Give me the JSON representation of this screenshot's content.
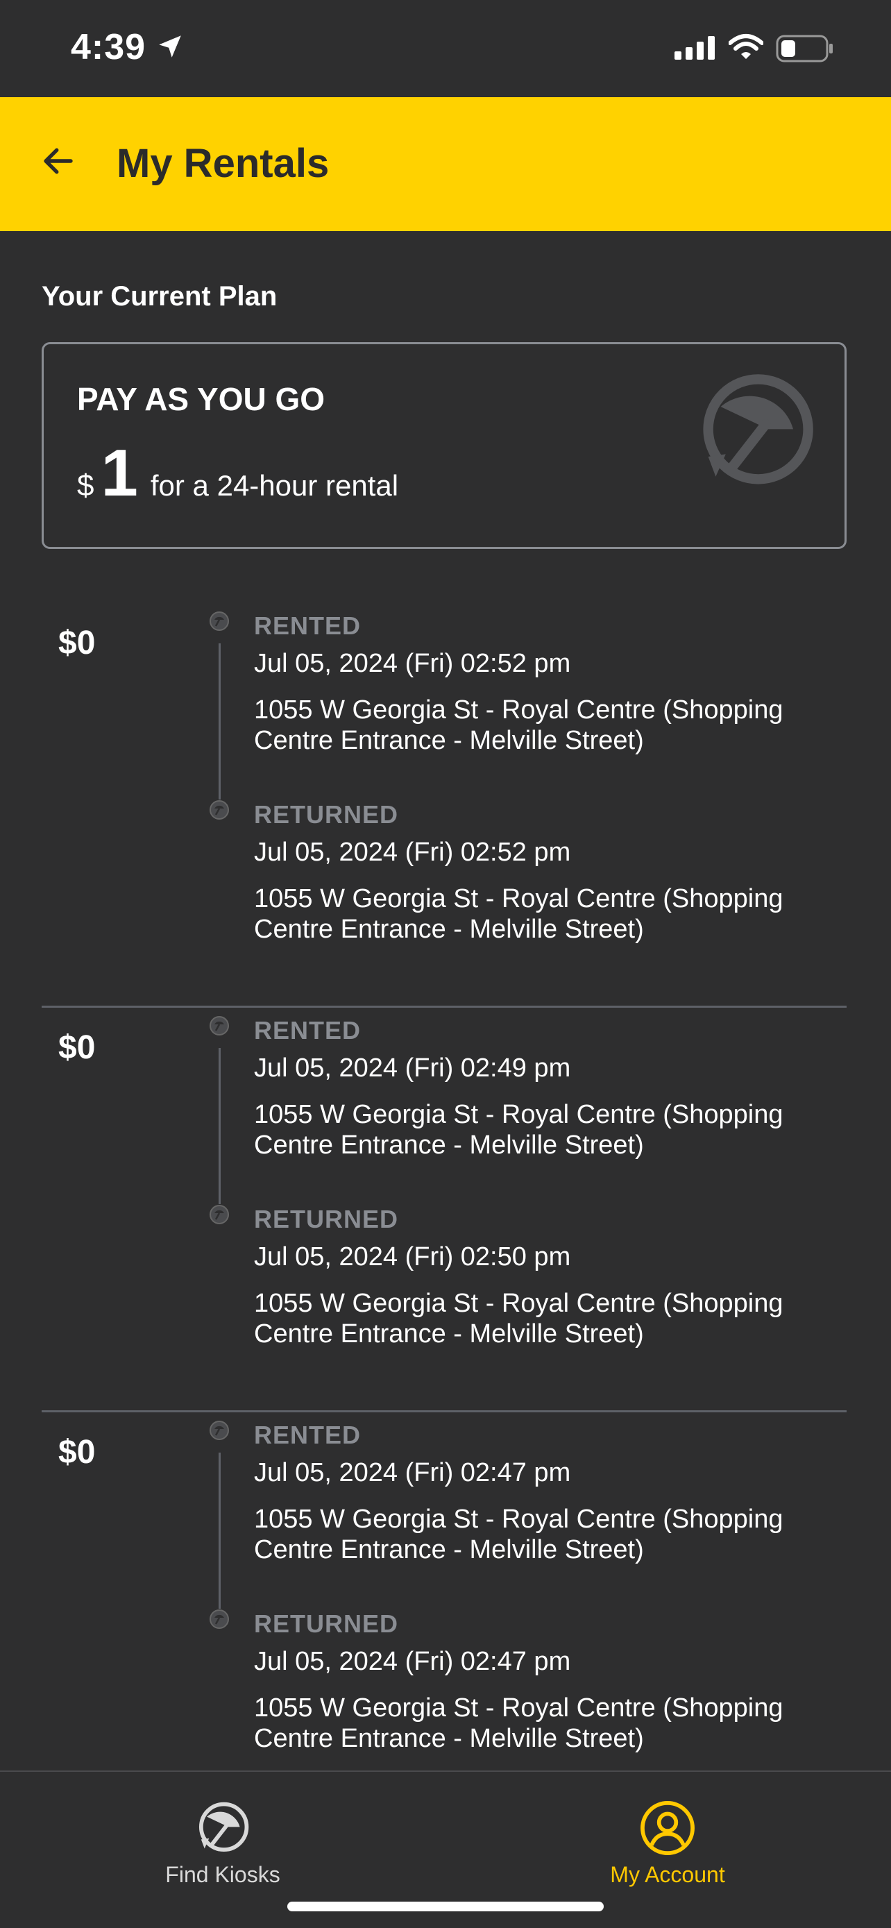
{
  "status_bar": {
    "time": "4:39"
  },
  "header": {
    "title": "My Rentals"
  },
  "plan": {
    "heading": "Your Current Plan",
    "name": "PAY AS YOU GO",
    "currency": "$",
    "amount": "1",
    "description": "for a 24-hour rental"
  },
  "rentals": [
    {
      "amount": "$0",
      "rented": {
        "label": "RENTED",
        "time": "Jul 05, 2024 (Fri) 02:52 pm",
        "location": "1055 W Georgia St - Royal Centre (Shopping Centre Entrance - Melville Street)"
      },
      "returned": {
        "label": "RETURNED",
        "time": "Jul 05, 2024 (Fri) 02:52 pm",
        "location": "1055 W Georgia St - Royal Centre (Shopping Centre Entrance - Melville Street)"
      }
    },
    {
      "amount": "$0",
      "rented": {
        "label": "RENTED",
        "time": "Jul 05, 2024 (Fri) 02:49 pm",
        "location": "1055 W Georgia St - Royal Centre (Shopping Centre Entrance - Melville Street)"
      },
      "returned": {
        "label": "RETURNED",
        "time": "Jul 05, 2024 (Fri) 02:50 pm",
        "location": "1055 W Georgia St - Royal Centre (Shopping Centre Entrance - Melville Street)"
      }
    },
    {
      "amount": "$0",
      "rented": {
        "label": "RENTED",
        "time": "Jul 05, 2024 (Fri) 02:47 pm",
        "location": "1055 W Georgia St - Royal Centre (Shopping Centre Entrance - Melville Street)"
      },
      "returned": {
        "label": "RETURNED",
        "time": "Jul 05, 2024 (Fri) 02:47 pm",
        "location": "1055 W Georgia St - Royal Centre (Shopping Centre Entrance - Melville Street)"
      }
    }
  ],
  "tab_bar": {
    "find_kiosks": "Find Kiosks",
    "my_account": "My Account"
  },
  "colors": {
    "accent": "#ffd200",
    "background": "#2e2e2f",
    "active_tab": "#ffc800",
    "muted": "#8a8d93"
  },
  "icons": {
    "back": "arrow-left-icon",
    "plan": "umbrella-logo-icon",
    "event": "umbrella-dot-icon",
    "find_kiosks": "umbrella-logo-icon",
    "my_account": "user-circle-icon"
  }
}
